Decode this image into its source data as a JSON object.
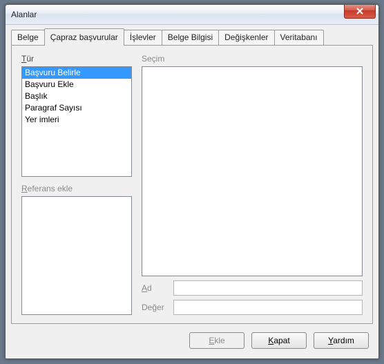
{
  "window": {
    "title": "Alanlar"
  },
  "tabs": [
    {
      "label": "Belge"
    },
    {
      "label": "Çapraz başvurular",
      "active": true
    },
    {
      "label": "İşlevler"
    },
    {
      "label": "Belge Bilgisi"
    },
    {
      "label": "Değişkenler"
    },
    {
      "label": "Veritabanı"
    }
  ],
  "labels": {
    "type_prefix": "T",
    "type_rest": "ür",
    "selection": "Seçim",
    "ref_prefix": "R",
    "ref_rest": "eferans ekle",
    "name_prefix": "A",
    "name_rest": "d",
    "value": "Değer"
  },
  "type_items": [
    "Başvuru Belirle",
    "Başvuru Ekle",
    "Başlık",
    "Paragraf Sayısı",
    "Yer imleri"
  ],
  "fields": {
    "name": "",
    "value": ""
  },
  "buttons": {
    "insert_prefix": "E",
    "insert_rest": "kle",
    "close_prefix": "K",
    "close_rest": "apat",
    "help_prefix": "Y",
    "help_rest": "ardım"
  }
}
